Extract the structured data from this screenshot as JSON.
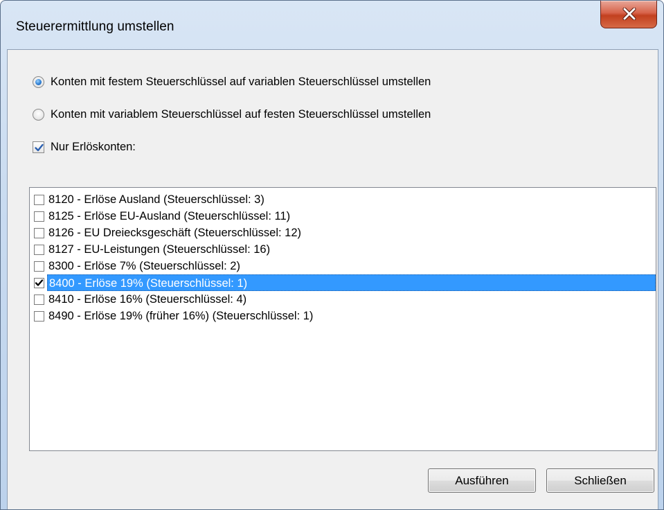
{
  "window": {
    "title": "Steuerermittlung umstellen"
  },
  "options": {
    "radio_fixed_to_variable": {
      "label": "Konten mit festem Steuerschlüssel auf variablen Steuerschlüssel umstellen",
      "checked": true
    },
    "radio_variable_to_fixed": {
      "label": "Konten mit variablem Steuerschlüssel auf festen Steuerschlüssel umstellen",
      "checked": false
    },
    "only_revenue_accounts": {
      "label": "Nur Erlöskonten:",
      "checked": true
    }
  },
  "accounts": [
    {
      "label": "8120 - Erlöse Ausland (Steuerschlüssel: 3)",
      "checked": false,
      "selected": false
    },
    {
      "label": "8125 - Erlöse EU-Ausland (Steuerschlüssel: 11)",
      "checked": false,
      "selected": false
    },
    {
      "label": "8126 - EU Dreiecksgeschäft (Steuerschlüssel: 12)",
      "checked": false,
      "selected": false
    },
    {
      "label": "8127 - EU-Leistungen (Steuerschlüssel: 16)",
      "checked": false,
      "selected": false
    },
    {
      "label": "8300 - Erlöse 7% (Steuerschlüssel: 2)",
      "checked": false,
      "selected": false
    },
    {
      "label": "8400 - Erlöse 19% (Steuerschlüssel: 1)",
      "checked": true,
      "selected": true
    },
    {
      "label": "8410 - Erlöse 16% (Steuerschlüssel: 4)",
      "checked": false,
      "selected": false
    },
    {
      "label": "8490 - Erlöse 19% (früher 16%) (Steuerschlüssel: 1)",
      "checked": false,
      "selected": false
    }
  ],
  "buttons": {
    "execute_label": "Ausführen",
    "close_label": "Schließen"
  },
  "colors": {
    "selection": "#3399ff",
    "close_button": "#c7452a"
  }
}
